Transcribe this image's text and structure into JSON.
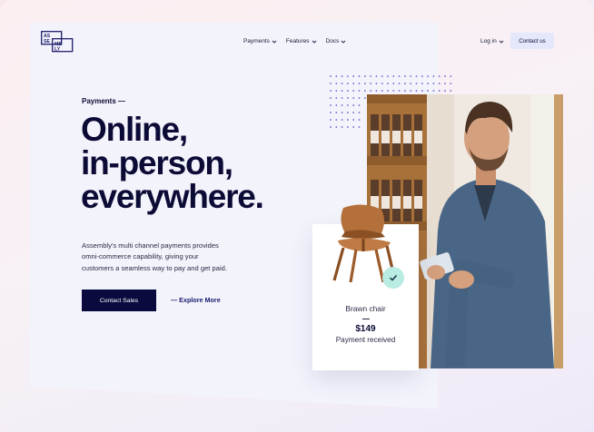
{
  "header": {
    "logo_lines": [
      "AS",
      "SE",
      "MB",
      "LY"
    ],
    "nav": [
      {
        "label": "Payments"
      },
      {
        "label": "Features"
      },
      {
        "label": "Docs"
      }
    ],
    "login_label": "Log in",
    "contact_label": "Contact us"
  },
  "hero": {
    "eyebrow": "Payments —",
    "headline_lines": [
      "Online,",
      "in-person,",
      "everywhere."
    ],
    "description_lines": [
      "Assembly's multi channel payments provides",
      "omni-commerce capability, giving your",
      "customers a seamless way to pay and get paid."
    ],
    "primary_cta": "Contact Sales",
    "secondary_cta": "— Explore More"
  },
  "product": {
    "name": "Brawn chair",
    "price": "$149",
    "status": "Payment received"
  },
  "colors": {
    "navy": "#0a0a3f",
    "accent_blue": "#1a1a6e",
    "check_bg": "#b9ece2",
    "dots": "#6b5cc9"
  }
}
